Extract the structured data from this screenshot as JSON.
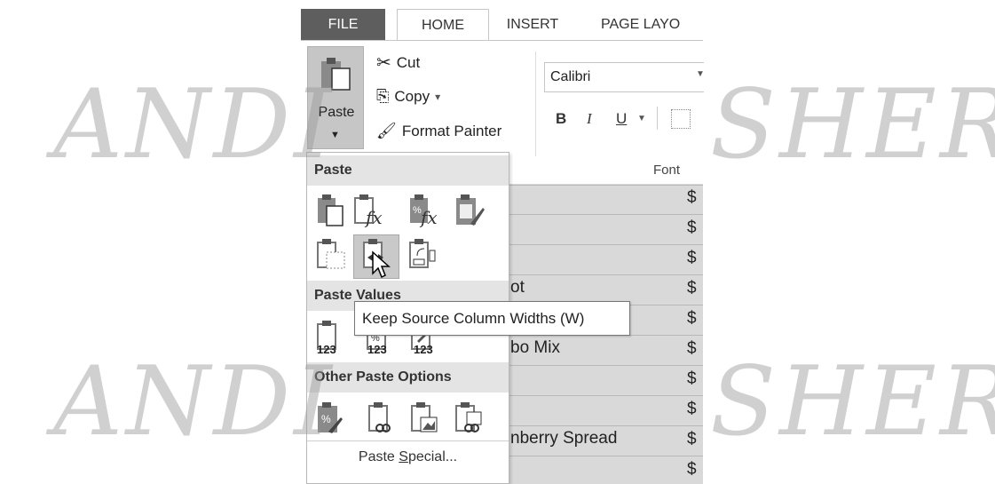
{
  "tabs": {
    "file": "FILE",
    "home": "HOME",
    "insert": "INSERT",
    "page_layout": "PAGE LAYO"
  },
  "clipboard": {
    "paste_label": "Paste",
    "cut_label": "Cut",
    "copy_label": "Copy",
    "copy_dropdown": "▾",
    "format_painter_label": "Format Painter",
    "launcher": "⌟"
  },
  "font": {
    "name": "Calibri",
    "bold": "B",
    "italic": "I",
    "underline": "U",
    "group_label": "Font"
  },
  "menu": {
    "paste_header": "Paste",
    "paste_values_header": "Paste Values",
    "other_header": "Other Paste Options",
    "paste_special_pre": "Paste ",
    "paste_special_ul": "S",
    "paste_special_post": "pecial...",
    "value_badge": "123"
  },
  "tooltip": {
    "text": "Keep Source Column Widths (W)"
  },
  "sheet": {
    "cells": [
      "ot",
      "bo Mix",
      "nberry Spread"
    ],
    "dollar": "$"
  },
  "watermark": {
    "left": "ANDI",
    "right": "SHER"
  }
}
